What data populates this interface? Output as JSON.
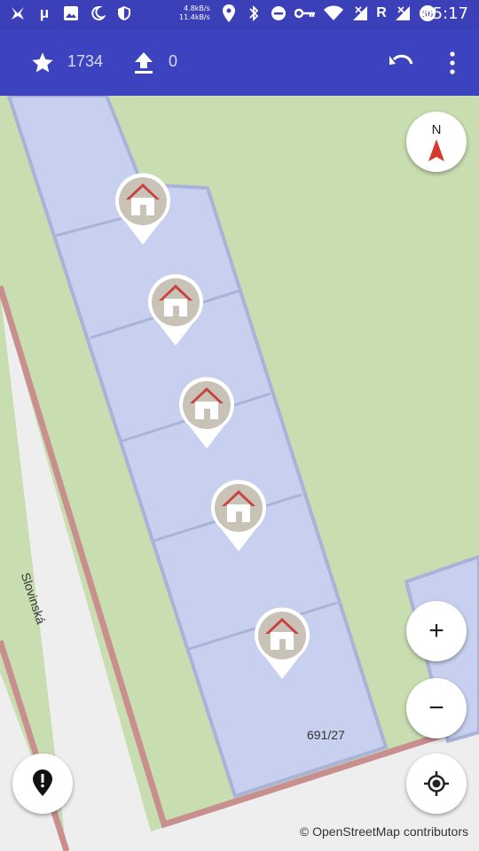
{
  "status_bar": {
    "speed_up": "4.8kB/s",
    "speed_down": "11.4kB/s",
    "battery": "56",
    "time": "05:17",
    "icons": [
      "sword-icon",
      "mu-icon",
      "image-icon",
      "moon-icon",
      "shield-icon",
      "location-icon",
      "bluetooth-icon",
      "dnd-icon",
      "key-icon",
      "wifi-icon",
      "signal-r-icon",
      "signal-x-icon",
      "battery-icon"
    ],
    "mu_label": "μ",
    "r_label": "R"
  },
  "toolbar": {
    "stars_count": "1734",
    "upload_count": "0",
    "icons": [
      "star-icon",
      "upload-icon",
      "undo-icon",
      "more-vert-icon"
    ],
    "color": "#3d43bf"
  },
  "map": {
    "street_label": "Slovinská",
    "house_number": "691/27",
    "attribution": "© OpenStreetMap contributors",
    "pin_icon": "house-icon",
    "colors": {
      "grass": "#c8ddb0",
      "building": "#c7d0ee",
      "road": "#eeeeee",
      "boundary": "#c98f8f"
    }
  },
  "controls": {
    "compass_letter": "N",
    "zoom_in_label": "+",
    "zoom_out_label": "−"
  }
}
